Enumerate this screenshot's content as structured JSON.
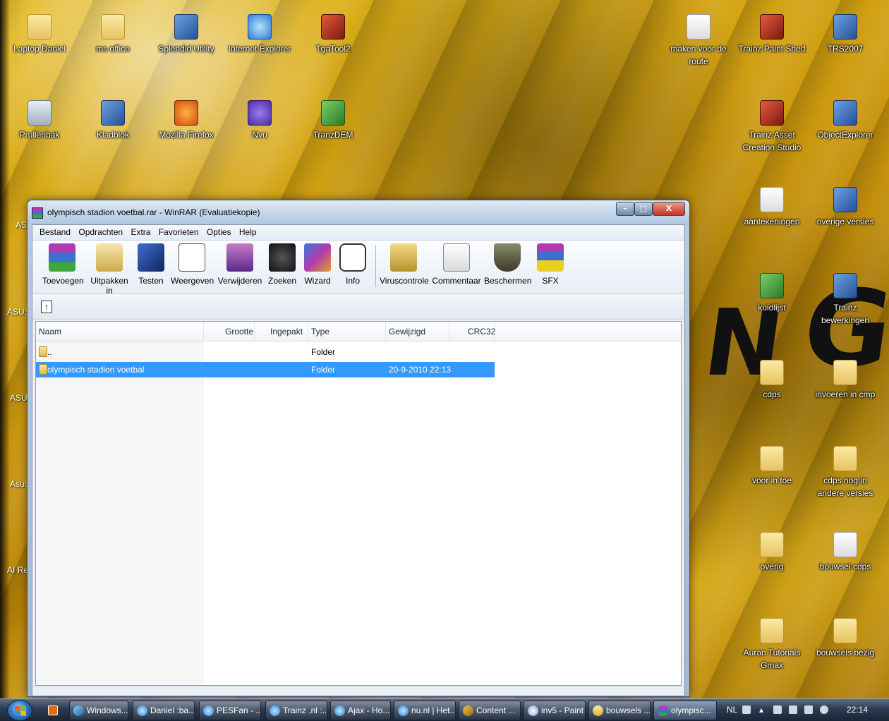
{
  "desktop": {
    "icons_left": [
      {
        "label": "Laptop Daniel"
      },
      {
        "label": "ms office"
      },
      {
        "label": "Splendid Utility"
      },
      {
        "label": "Internet Explorer"
      },
      {
        "label": "TgaTool2"
      },
      {
        "label": "Prullenbak"
      },
      {
        "label": "Kladblok"
      },
      {
        "label": "Mozilla Firefox"
      },
      {
        "label": "Nvu"
      },
      {
        "label": "TranzDEM"
      }
    ],
    "icons_right": [
      {
        "label": "maken voor de route"
      },
      {
        "label": "Trainz Paint Shed"
      },
      {
        "label": "TRS2007"
      },
      {
        "label": "Trainz Asset Creation Studio"
      },
      {
        "label": "ObjectExplorer"
      },
      {
        "label": "aantekeningen"
      },
      {
        "label": "overige versies"
      },
      {
        "label": "kuidlijst"
      },
      {
        "label": "Trainz bewerkingen"
      },
      {
        "label": "cdps"
      },
      {
        "label": "invoeren in cmp"
      },
      {
        "label": "voor in toe"
      },
      {
        "label": "cdps nog in andere versies"
      },
      {
        "label": "overig"
      },
      {
        "label": "bouwsel cdps"
      },
      {
        "label": "Auran Tutorials Gmax"
      },
      {
        "label": "bouwsels bezig"
      }
    ],
    "side_labels": [
      "AS",
      "ASUS",
      "ASU",
      "Asus",
      "AI Re"
    ]
  },
  "winrar": {
    "title": "olympisch stadion voetbal.rar - WinRAR (Evaluatiekopie)",
    "window_buttons": {
      "minimize": "–",
      "maximize": "□",
      "close": "X"
    },
    "menu": [
      "Bestand",
      "Opdrachten",
      "Extra",
      "Favorieten",
      "Opties",
      "Help"
    ],
    "toolbar": [
      {
        "label": "Toevoegen",
        "icon": "add-archive-icon"
      },
      {
        "label": "Uitpakken in",
        "icon": "extract-icon"
      },
      {
        "label": "Testen",
        "icon": "test-icon"
      },
      {
        "label": "Weergeven",
        "icon": "view-icon"
      },
      {
        "label": "Verwijderen",
        "icon": "delete-icon"
      },
      {
        "label": "Zoeken",
        "icon": "find-icon"
      },
      {
        "label": "Wizard",
        "icon": "wizard-icon"
      },
      {
        "label": "Info",
        "icon": "info-icon"
      },
      {
        "label": "Viruscontrole",
        "icon": "virus-scan-icon"
      },
      {
        "label": "Commentaar",
        "icon": "comment-icon"
      },
      {
        "label": "Beschermen",
        "icon": "protect-icon"
      },
      {
        "label": "SFX",
        "icon": "sfx-icon"
      }
    ],
    "columns": [
      "Naam",
      "Grootte",
      "Ingepakt",
      "Type",
      "Gewijzigd",
      "CRC32"
    ],
    "rows": [
      {
        "name": "..",
        "size": "",
        "packed": "",
        "type": "Folder",
        "modified": "",
        "crc": ""
      },
      {
        "name": "olympisch stadion voetbal",
        "size": "",
        "packed": "",
        "type": "Folder",
        "modified": "20-9-2010 22:13",
        "crc": ""
      }
    ]
  },
  "taskbar": {
    "buttons": [
      {
        "label": "Windows...",
        "icon": "windows-explorer-icon"
      },
      {
        "label": "Daniel :ba...",
        "icon": "internet-explorer-icon"
      },
      {
        "label": "PESFan - ...",
        "icon": "internet-explorer-icon"
      },
      {
        "label": "Trainz .nl :...",
        "icon": "internet-explorer-icon"
      },
      {
        "label": "Ajax - Ho...",
        "icon": "internet-explorer-icon"
      },
      {
        "label": "nu.nl | Het...",
        "icon": "internet-explorer-icon"
      },
      {
        "label": "Content ...",
        "icon": "content-icon"
      },
      {
        "label": "inv5 - Paint",
        "icon": "paint-icon"
      },
      {
        "label": "bouwsels ...",
        "icon": "folder-icon"
      },
      {
        "label": "olympisc...",
        "icon": "winrar-icon"
      }
    ],
    "language": "NL",
    "clock": "22:14"
  }
}
